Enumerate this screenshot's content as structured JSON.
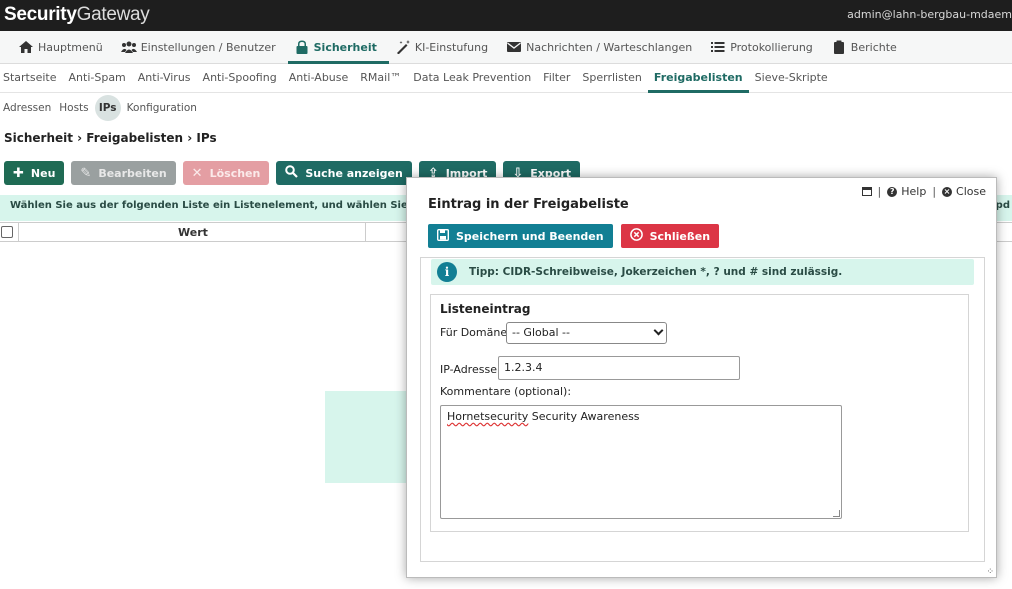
{
  "app": {
    "brand_bold": "Security",
    "brand_light": "Gateway",
    "user": "admin@lahn-bergbau-mdaem"
  },
  "main_nav": [
    {
      "label": "Hauptmenü",
      "icon": "home-icon"
    },
    {
      "label": "Einstellungen / Benutzer",
      "icon": "users-icon"
    },
    {
      "label": "Sicherheit",
      "icon": "lock-icon",
      "active": true
    },
    {
      "label": "KI-Einstufung",
      "icon": "magic-wand-icon"
    },
    {
      "label": "Nachrichten / Warteschlangen",
      "icon": "envelope-icon"
    },
    {
      "label": "Protokollierung",
      "icon": "list-icon"
    },
    {
      "label": "Berichte",
      "icon": "clipboard-icon"
    }
  ],
  "sub_nav": [
    "Startseite",
    "Anti-Spam",
    "Anti-Virus",
    "Anti-Spoofing",
    "Anti-Abuse",
    "RMail™",
    "Data Leak Prevention",
    "Filter",
    "Sperrlisten",
    "Freigabelisten",
    "Sieve-Skripte"
  ],
  "sub_nav_active": "Freigabelisten",
  "subsub_nav": [
    "Adressen",
    "Hosts",
    "IPs",
    "Konfiguration"
  ],
  "subsub_active": "IPs",
  "breadcrumb": "Sicherheit › Freigabelisten › IPs",
  "toolbar": {
    "new": "Neu",
    "edit": "Bearbeiten",
    "delete": "Löschen",
    "search": "Suche anzeigen",
    "import": "Import",
    "export": "Export"
  },
  "info_text": "Wählen Sie aus der folgenden Liste ein Listenelement, und wählen Sie danach e",
  "info_text_right": "pd",
  "table": {
    "columns": [
      "Wert"
    ]
  },
  "modal": {
    "help": "Help",
    "close": "Close",
    "title": "Eintrag in der Freigabeliste",
    "save_button": "Speichern und Beenden",
    "close_button": "Schließen",
    "tip": "Tipp: CIDR-Schreibweise, Jokerzeichen *, ? und # sind zulässig.",
    "legend": "Listeneintrag",
    "domain_label": "Für Domäne:",
    "domain_value": "-- Global --",
    "ip_label": "IP-Adresse:",
    "ip_value": "1.2.3.4",
    "comment_label": "Kommentare (optional):",
    "comment_word1": "Hornetsecurity",
    "comment_rest": " Security Awareness"
  },
  "colors": {
    "accent": "#1f6b64",
    "save": "#127f94",
    "danger": "#dc3545",
    "info_bg": "#d7f5ec"
  }
}
